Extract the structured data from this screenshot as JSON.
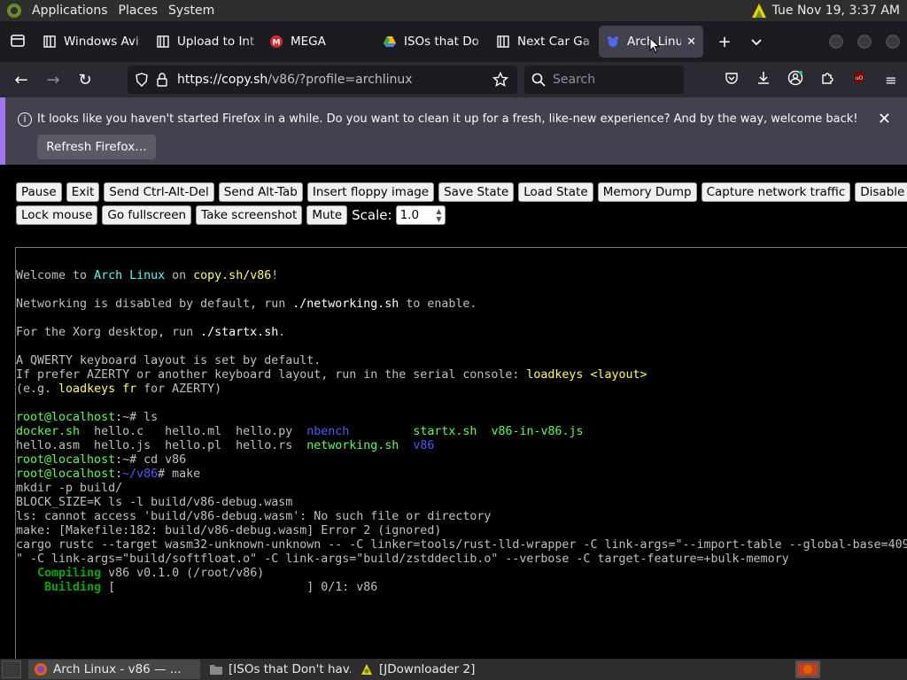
{
  "top_panel": {
    "menus": [
      "Applications",
      "Places",
      "System"
    ],
    "clock": "Tue Nov 19,  3:37 AM"
  },
  "tabs": [
    {
      "title": "Windows Avi",
      "icon": "page-icon"
    },
    {
      "title": "Upload to Int",
      "icon": "page-icon"
    },
    {
      "title": "MEGA",
      "icon": "mega-icon"
    },
    {
      "title": "ISOs that Do",
      "icon": "drive-icon"
    },
    {
      "title": "Next Car Gan",
      "icon": "page-icon"
    },
    {
      "title": "Arch Linux",
      "icon": "v86-icon",
      "active": true
    }
  ],
  "urlbar": {
    "host": "https://copy.sh",
    "path": "/v86/?profile=archlinux"
  },
  "searchbar": {
    "placeholder": "Search"
  },
  "notification": {
    "message": "It looks like you haven't started Firefox in a while. Do you want to clean it up for a fresh, like-new experience? And by the way, welcome back!",
    "button": "Refresh Firefox…"
  },
  "controls": {
    "row1": [
      "Pause",
      "Exit",
      "Send Ctrl-Alt-Del",
      "Send Alt-Tab",
      "Insert floppy image",
      "Save State",
      "Load State",
      "Memory Dump",
      "Capture network traffic",
      "Disable mouse"
    ],
    "row2": [
      "Lock mouse",
      "Go fullscreen",
      "Take screenshot",
      "Mute"
    ],
    "scale_label": "Scale:",
    "scale_value": "1.0"
  },
  "terminal": {
    "colors": {
      "cyan": "#54ffff",
      "yellow": "#ffff54",
      "green": "#54ff54",
      "blue": "#5454ff",
      "text": "#c0c0c0"
    },
    "lines": [
      [
        {
          "t": ""
        }
      ],
      [
        {
          "t": "Welcome to "
        },
        {
          "t": "Arch Linux",
          "c": "cyan"
        },
        {
          "t": " on "
        },
        {
          "t": "copy.sh/v86",
          "c": "yellow"
        },
        {
          "t": "!"
        }
      ],
      [
        {
          "t": ""
        }
      ],
      [
        {
          "t": "Networking is disabled by default, run "
        },
        {
          "t": "./networking.sh",
          "c": "white"
        },
        {
          "t": " to enable."
        }
      ],
      [
        {
          "t": ""
        }
      ],
      [
        {
          "t": "For the Xorg desktop, run "
        },
        {
          "t": "./startx.sh",
          "c": "white"
        },
        {
          "t": "."
        }
      ],
      [
        {
          "t": ""
        }
      ],
      [
        {
          "t": "A QWERTY keyboard layout is set by default."
        }
      ],
      [
        {
          "t": "If prefer AZERTY or another keyboard layout, run in the serial console: "
        },
        {
          "t": "loadkeys <layout>",
          "c": "yellow"
        }
      ],
      [
        {
          "t": "(e.g. "
        },
        {
          "t": "loadkeys fr",
          "c": "yellow"
        },
        {
          "t": " for AZERTY)"
        }
      ],
      [
        {
          "t": ""
        }
      ],
      [
        {
          "t": "root@localhost",
          "c": "green"
        },
        {
          "t": ":~# ls"
        }
      ],
      [
        {
          "t": "docker.sh",
          "c": "green"
        },
        {
          "t": "  hello.c   hello.ml  hello.py  "
        },
        {
          "t": "nbench",
          "c": "blue"
        },
        {
          "t": "         "
        },
        {
          "t": "startx.sh",
          "c": "green"
        },
        {
          "t": "  "
        },
        {
          "t": "v86-in-v86.js",
          "c": "green"
        }
      ],
      [
        {
          "t": "hello.asm  hello.js  hello.pl  hello.rs  "
        },
        {
          "t": "networking.sh",
          "c": "green"
        },
        {
          "t": "  "
        },
        {
          "t": "v86",
          "c": "blue"
        }
      ],
      [
        {
          "t": "root@localhost",
          "c": "green"
        },
        {
          "t": ":~# cd v86"
        }
      ],
      [
        {
          "t": "root@localhost",
          "c": "green"
        },
        {
          "t": ":"
        },
        {
          "t": "~/v86",
          "c": "blue"
        },
        {
          "t": "# make"
        }
      ],
      [
        {
          "t": "mkdir -p build/"
        }
      ],
      [
        {
          "t": "BLOCK_SIZE=K ls -l build/v86-debug.wasm"
        }
      ],
      [
        {
          "t": "ls: cannot access 'build/v86-debug.wasm': No such file or directory"
        }
      ],
      [
        {
          "t": "make: [Makefile:182: build/v86-debug.wasm] Error 2 (ignored)"
        }
      ],
      [
        {
          "t": "cargo rustc --target wasm32-unknown-unknown -- -C linker=tools/rust-lld-wrapper -C link-args=\"--import-table --global-base=409"
        }
      ],
      [
        {
          "t": "\" -C link-args=\"build/softfloat.o\" -C link-args=\"build/zstddeclib.o\" --verbose -C target-feature=+bulk-memory"
        }
      ],
      [
        {
          "t": "   "
        },
        {
          "t": "Compiling",
          "c": "bgreen"
        },
        {
          "t": " v86 v0.1.0 (/root/v86)"
        }
      ],
      [
        {
          "t": "    "
        },
        {
          "t": "Building",
          "c": "bgreen"
        },
        {
          "t": " [                           ] 0/1: v86"
        }
      ]
    ]
  },
  "taskbar": {
    "items": [
      {
        "label": "Arch Linux - v86 — ...",
        "icon": "firefox-icon",
        "active": true
      },
      {
        "label": "[ISOs that Don't hav...",
        "icon": "folder-icon"
      },
      {
        "label": "[JDownloader 2]",
        "icon": "jdownloader-icon"
      }
    ]
  }
}
